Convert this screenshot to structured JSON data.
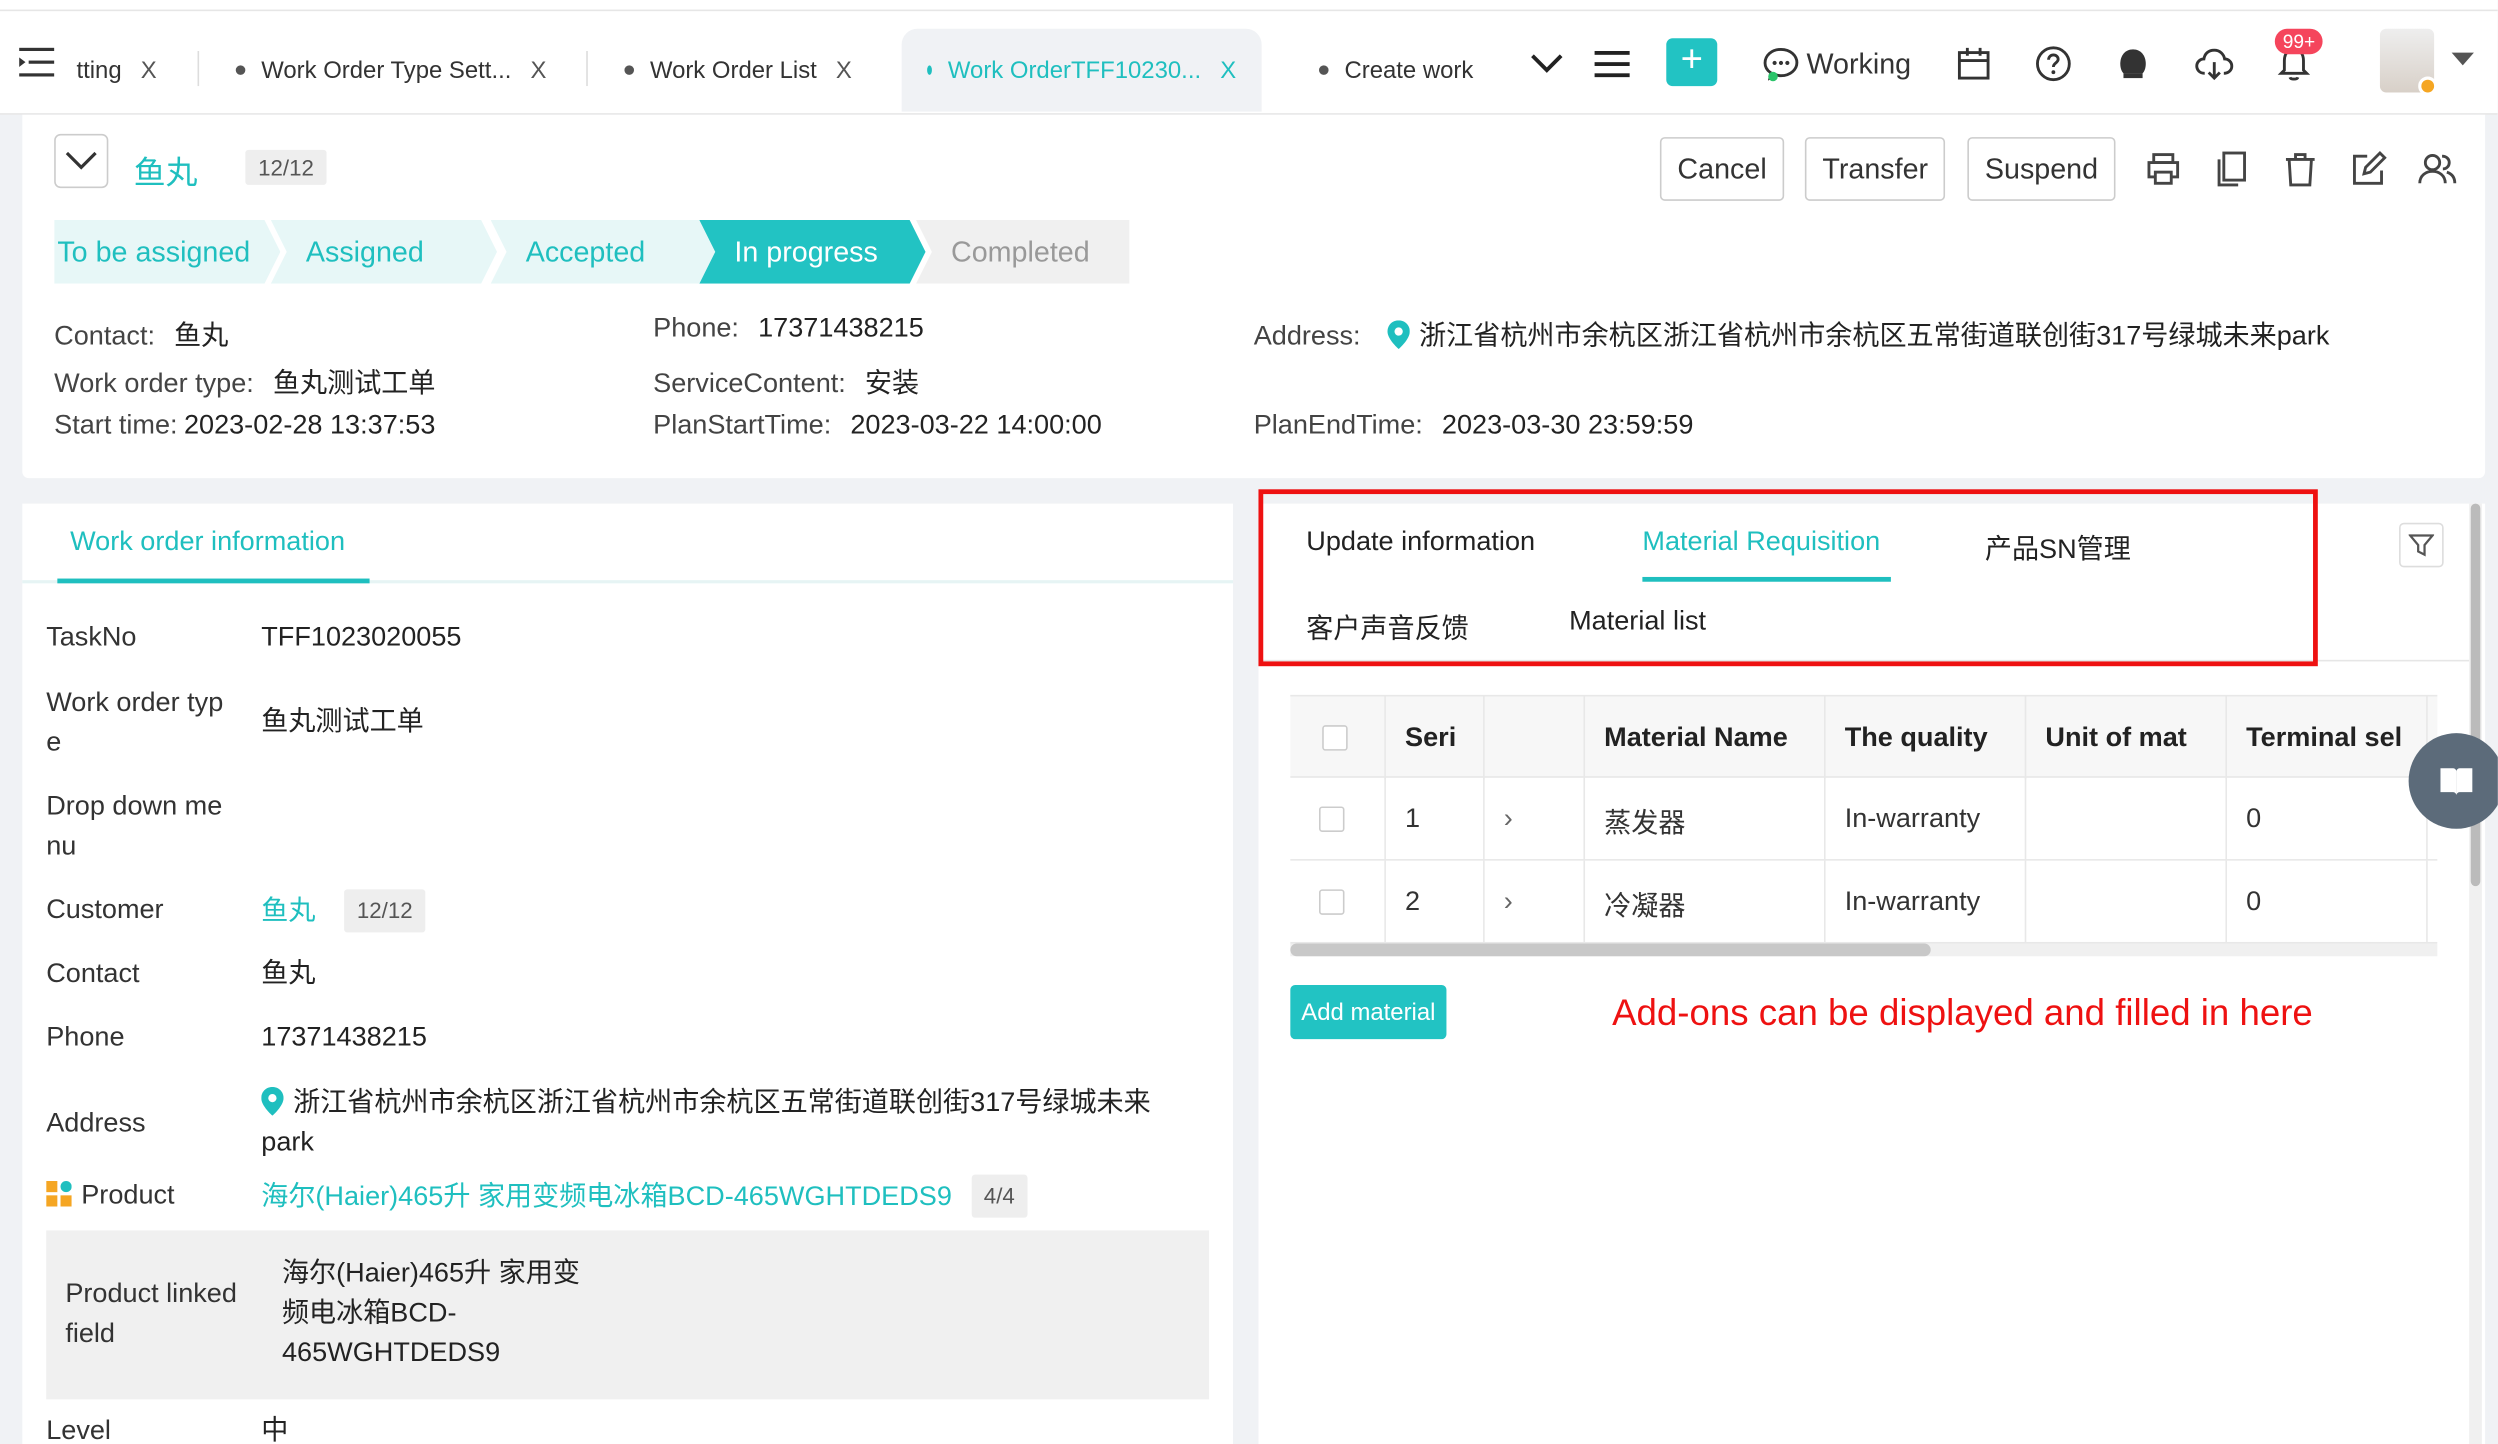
{
  "topbar": {
    "tabs": [
      {
        "label": "tting",
        "close": "X"
      },
      {
        "label": "Work Order Type Sett...",
        "close": "X"
      },
      {
        "label": "Work Order List",
        "close": "X"
      },
      {
        "label": "Work OrderTFF10230...",
        "close": "X"
      },
      {
        "label": "Create work"
      }
    ],
    "working_label": "Working",
    "notification_badge": "99+"
  },
  "header": {
    "customer_name": "鱼丸",
    "customer_count": "12/12",
    "buttons": {
      "cancel": "Cancel",
      "transfer": "Transfer",
      "suspend": "Suspend"
    },
    "steps": [
      "To be assigned",
      "Assigned",
      "Accepted",
      "In progress",
      "Completed"
    ],
    "current_step": "In progress",
    "info": {
      "contact_label": "Contact:",
      "contact": "鱼丸",
      "phone_label": "Phone:",
      "phone": "17371438215",
      "address_label": "Address:",
      "address": "浙江省杭州市余杭区浙江省杭州市余杭区五常街道联创街317号绿城未来park",
      "type_label": "Work order type:",
      "type": "鱼丸测试工单",
      "service_label": "ServiceContent:",
      "service": "安装",
      "start_label": "Start time:",
      "start": "2023-02-28 13:37:53",
      "plan_start_label": "PlanStartTime:",
      "plan_start": "2023-03-22 14:00:00",
      "plan_end_label": "PlanEndTime:",
      "plan_end": "2023-03-30 23:59:59"
    }
  },
  "left": {
    "tab": "Work order information",
    "fields": {
      "taskno_label": "TaskNo",
      "taskno": "TFF1023020055",
      "type_label_1": "Work order typ",
      "type_label_2": "e",
      "type": "鱼丸测试工单",
      "dropdown_label_1": "Drop down me",
      "dropdown_label_2": "nu",
      "customer_label": "Customer",
      "customer": "鱼丸",
      "customer_count": "12/12",
      "contact_label": "Contact",
      "contact": "鱼丸",
      "phone_label": "Phone",
      "phone": "17371438215",
      "address_label": "Address",
      "address_1": "浙江省杭州市余杭区浙江省杭州市余杭区五常街道联创街317号绿城未来",
      "address_2": "park",
      "product_label": "Product",
      "product": "海尔(Haier)465升 家用变频电冰箱BCD-465WGHTDEDS9",
      "product_count": "4/4",
      "linked_label_1": "Product linked",
      "linked_label_2": "field",
      "linked_1": "海尔(Haier)465升 家用变",
      "linked_2": "频电冰箱BCD-",
      "linked_3": "465WGHTDEDS9",
      "level_label": "Level",
      "level": "中"
    }
  },
  "right": {
    "tabs": [
      "Update information",
      "Material Requisition",
      "产品SN管理",
      "客户声音反馈",
      "Material list"
    ],
    "active_tab": "Material Requisition",
    "table": {
      "columns": [
        "Seri",
        "",
        "Material Name",
        "The quality",
        "Unit of mat",
        "Terminal sel"
      ],
      "rows": [
        {
          "seri": "1",
          "arrow": "›",
          "name": "蒸发器",
          "quality": "In-warranty",
          "unit": "",
          "terminal": "0"
        },
        {
          "seri": "2",
          "arrow": "›",
          "name": "冷凝器",
          "quality": "In-warranty",
          "unit": "",
          "terminal": "0"
        }
      ]
    },
    "add_button": "Add material",
    "annotation": "Add-ons can be displayed and filled in here"
  },
  "colors": {
    "accent": "#22c3c3",
    "annotation": "#ee1111",
    "badge": "#f5455c"
  }
}
